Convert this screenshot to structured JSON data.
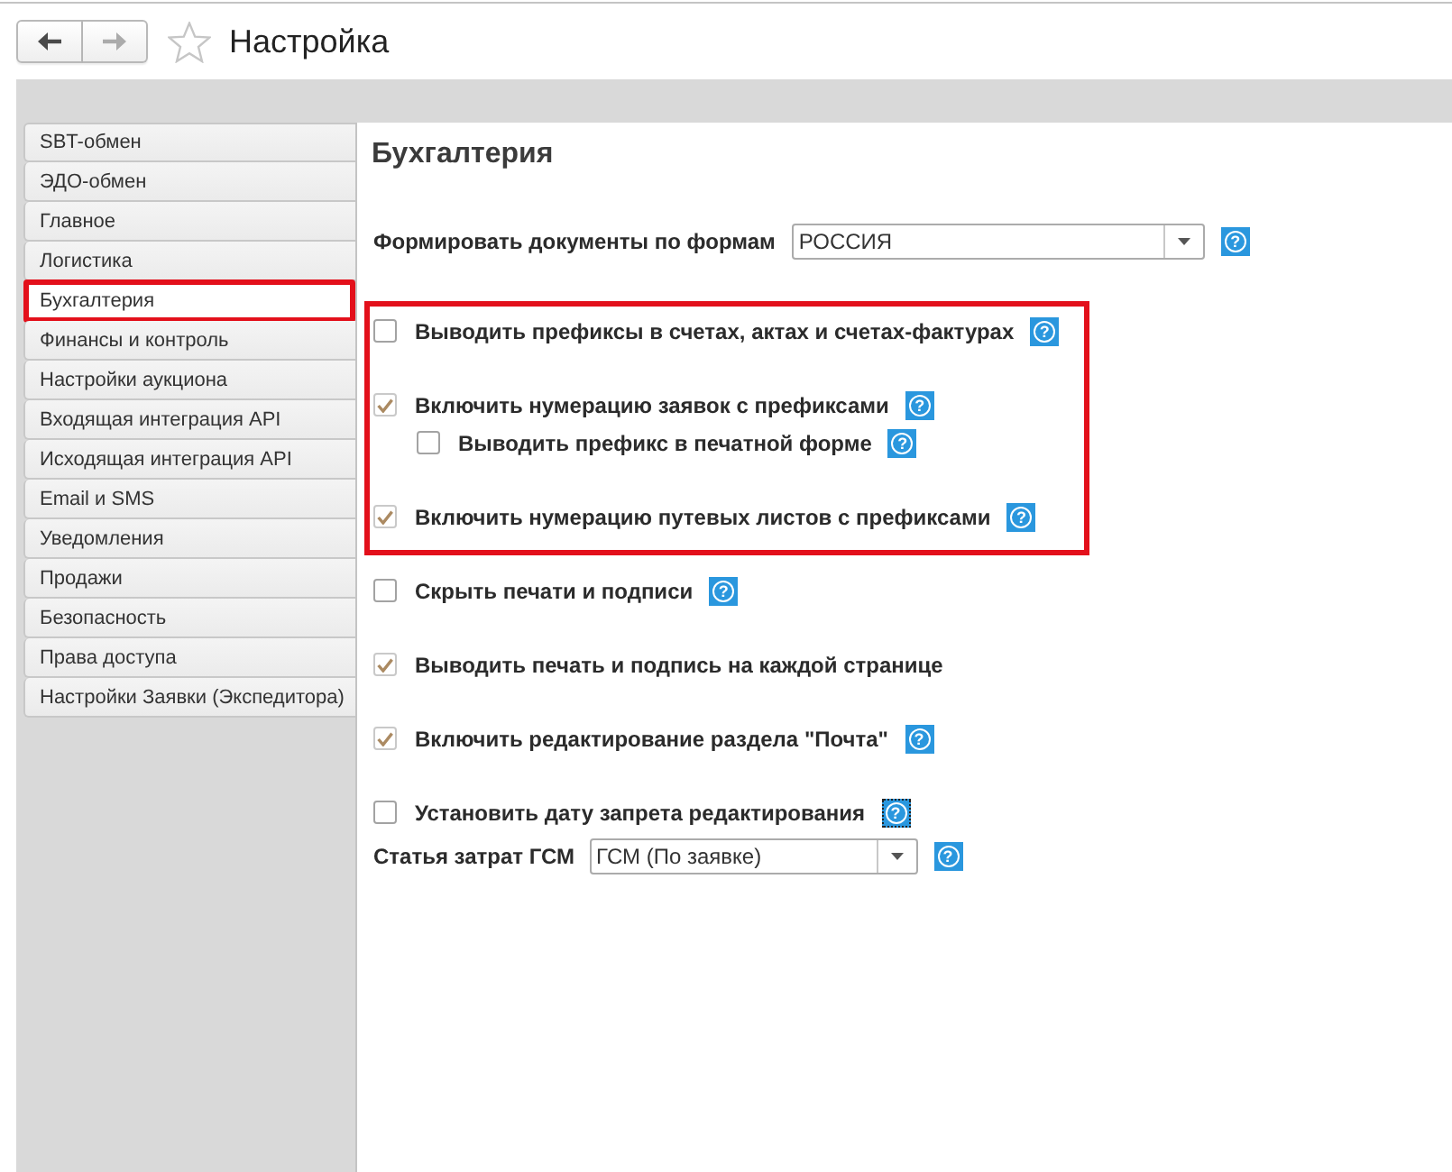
{
  "header": {
    "title": "Настройка",
    "back": {
      "disabled": false
    },
    "forward": {
      "disabled": true
    },
    "starred": false
  },
  "sidebar": {
    "items": [
      {
        "label": "SBT-обмен",
        "selected": false,
        "highlighted": false
      },
      {
        "label": "ЭДО-обмен",
        "selected": false,
        "highlighted": false
      },
      {
        "label": "Главное",
        "selected": false,
        "highlighted": false
      },
      {
        "label": "Логистика",
        "selected": false,
        "highlighted": false
      },
      {
        "label": "Бухгалтерия",
        "selected": true,
        "highlighted": true
      },
      {
        "label": "Финансы и контроль",
        "selected": false,
        "highlighted": false
      },
      {
        "label": "Настройки аукциона",
        "selected": false,
        "highlighted": false
      },
      {
        "label": "Входящая интеграция API",
        "selected": false,
        "highlighted": false
      },
      {
        "label": "Исходящая интеграция API",
        "selected": false,
        "highlighted": false
      },
      {
        "label": "Email и SMS",
        "selected": false,
        "highlighted": false
      },
      {
        "label": "Уведомления",
        "selected": false,
        "highlighted": false
      },
      {
        "label": "Продажи",
        "selected": false,
        "highlighted": false
      },
      {
        "label": "Безопасность",
        "selected": false,
        "highlighted": false
      },
      {
        "label": "Права доступа",
        "selected": false,
        "highlighted": false
      },
      {
        "label": "Настройки Заявки (Экспедитора)",
        "selected": false,
        "highlighted": false
      }
    ]
  },
  "form": {
    "title": "Бухгалтерия",
    "rows": [
      {
        "kind": "select",
        "label": "Формировать документы по формам",
        "value": "РОССИЯ",
        "help": {
          "text": "?",
          "focused": false
        }
      },
      {
        "kind": "frame",
        "highlighted": true,
        "rows": [
          {
            "kind": "checkbox",
            "label": "Выводить префиксы в счетах, актах и счетах-фактурах",
            "checked": false,
            "help": {
              "text": "?",
              "focused": false
            }
          },
          {
            "kind": "checkbox",
            "label": "Включить нумерацию заявок с префиксами",
            "checked": true,
            "help": {
              "text": "?",
              "focused": false
            },
            "children": [
              {
                "kind": "checkbox",
                "label": "Выводить префикс в печатной форме",
                "checked": false,
                "help": {
                  "text": "?",
                  "focused": false
                }
              }
            ]
          },
          {
            "kind": "checkbox",
            "label": "Включить нумерацию путевых листов с префиксами",
            "checked": true,
            "help": {
              "text": "?",
              "focused": false
            }
          }
        ]
      },
      {
        "kind": "checkbox",
        "label": "Скрыть печати и подписи",
        "checked": false,
        "help": {
          "text": "?",
          "focused": false
        }
      },
      {
        "kind": "checkbox",
        "label": "Выводить печать и подпись на каждой странице",
        "checked": true
      },
      {
        "kind": "checkbox",
        "label": "Включить редактирование раздела \"Почта\"",
        "checked": true,
        "help": {
          "text": "?",
          "focused": false
        }
      },
      {
        "kind": "checkbox",
        "label": "Установить дату запрета редактирования",
        "checked": false,
        "help": {
          "text": "?",
          "focused": true
        }
      },
      {
        "kind": "select",
        "label": "Статья затрат ГСМ",
        "value": "ГСМ (По заявке)",
        "help": {
          "text": "?",
          "focused": false
        }
      }
    ]
  }
}
